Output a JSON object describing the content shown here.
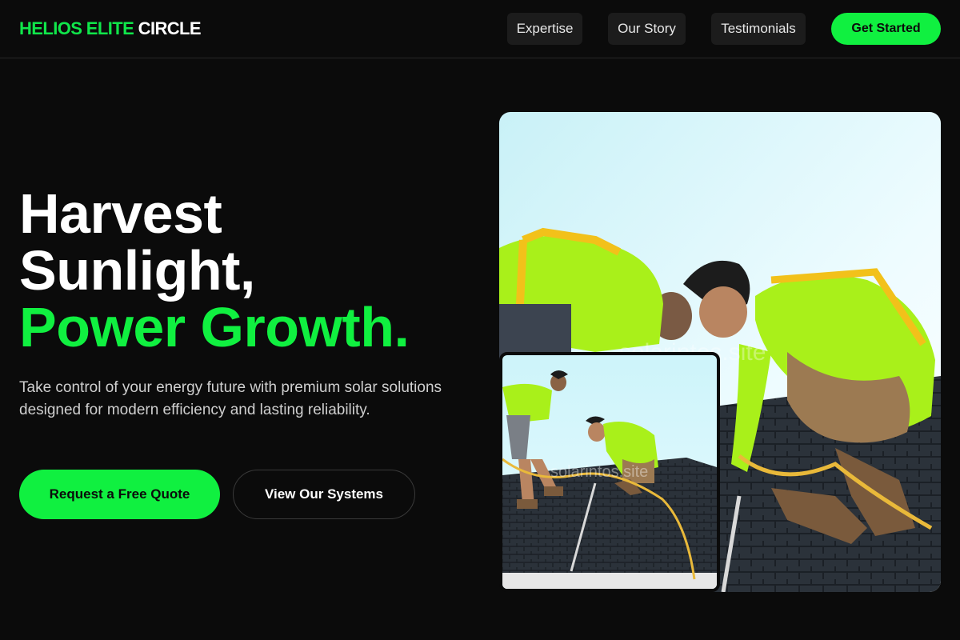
{
  "header": {
    "logo_accent": "HELIOS ELITE",
    "logo_plain": "CIRCLE",
    "nav": [
      {
        "label": "Expertise"
      },
      {
        "label": "Our Story"
      },
      {
        "label": "Testimonials"
      }
    ],
    "cta_label": "Get Started"
  },
  "hero": {
    "headline_line1": "Harvest",
    "headline_line2": "Sunlight,",
    "headline_line3": "Power Growth.",
    "subtext": "Take control of your energy future with premium solar solutions designed for modern efficiency and lasting reliability.",
    "primary_button": "Request a Free Quote",
    "secondary_button": "View Our Systems"
  },
  "images": {
    "main_alt": "Solar installers working on a shingled roof",
    "inset_alt": "Two solar installers in safety harnesses on a roof",
    "watermark": "solarintos.site"
  },
  "colors": {
    "accent": "#10f040",
    "background": "#0b0b0b",
    "nav_button_bg": "#1c1c1c"
  }
}
